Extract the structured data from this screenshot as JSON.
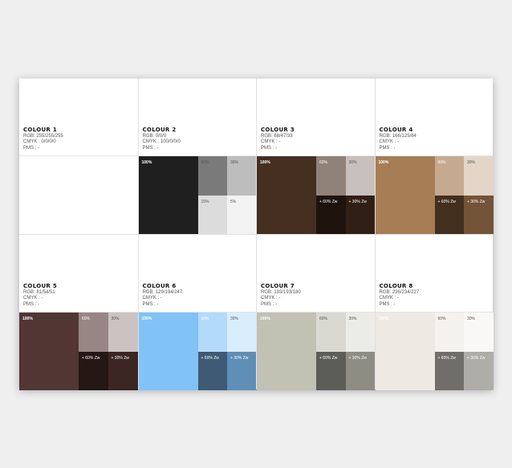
{
  "colours": [
    {
      "name": "COLOUR 1",
      "rgb": "RGB: 255/255/255",
      "cmyk": "CMYK : 0/0/0/0",
      "pms": "PMS : -",
      "swatches": {
        "main": {
          "color": "#ffffff",
          "label": ""
        },
        "t1": {
          "color": "#ffffff",
          "label": ""
        },
        "t2": {
          "color": "#ffffff",
          "label": ""
        },
        "b1": {
          "color": "#ffffff",
          "label": ""
        },
        "b2": {
          "color": "#ffffff",
          "label": ""
        }
      }
    },
    {
      "name": "COLOUR 2",
      "rgb": "RGB: 0/0/0",
      "cmyk": "CMYK : 100/0/0/0",
      "pms": "PMS : -",
      "swatches": {
        "main": {
          "color": "#1f1f1f",
          "label": "100%",
          "tone": "light"
        },
        "t1": {
          "color": "#7a7a7a",
          "label": "60%",
          "tone": "dark"
        },
        "t2": {
          "color": "#bdbdbd",
          "label": "30%",
          "tone": "dark"
        },
        "b1": {
          "color": "#dcdcdc",
          "label": "15%",
          "tone": "dark"
        },
        "b2": {
          "color": "#f3f3f3",
          "label": "5%",
          "tone": "dark"
        }
      }
    },
    {
      "name": "COLOUR 3",
      "rgb": "RGB: 68/47/33",
      "cmyk": "CMYK : -",
      "pms": "PMS : -",
      "swatches": {
        "main": {
          "color": "#442f21",
          "label": "100%",
          "tone": "light"
        },
        "t1": {
          "color": "#8f8279",
          "label": "60%",
          "tone": "light"
        },
        "t2": {
          "color": "#c7c0bc",
          "label": "30%",
          "tone": "dark"
        },
        "b1": {
          "color": "#1e130d",
          "label": "+ 60% Zw",
          "tone": "light"
        },
        "b2": {
          "color": "#301f15",
          "label": "+ 30% Zw",
          "tone": "light"
        }
      }
    },
    {
      "name": "COLOUR 4",
      "rgb": "RGB: 166/125/84",
      "cmyk": "CMYK : -",
      "pms": "PMS : -",
      "swatches": {
        "main": {
          "color": "#a67d54",
          "label": "100%",
          "tone": "light"
        },
        "t1": {
          "color": "#c6aa90",
          "label": "60%",
          "tone": "light"
        },
        "t2": {
          "color": "#e3d5c8",
          "label": "30%",
          "tone": "dark"
        },
        "b1": {
          "color": "#432f1e",
          "label": "+ 60% Zw",
          "tone": "light"
        },
        "b2": {
          "color": "#735438",
          "label": "+ 30% Zw",
          "tone": "light"
        }
      }
    },
    {
      "name": "COLOUR 5",
      "rgb": "RGB: 81/54/51",
      "cmyk": "CMYK : -",
      "pms": "PMS : -",
      "swatches": {
        "main": {
          "color": "#513633",
          "label": "100%",
          "tone": "light"
        },
        "t1": {
          "color": "#978685",
          "label": "60%",
          "tone": "light"
        },
        "t2": {
          "color": "#cbc2c1",
          "label": "30%",
          "tone": "dark"
        },
        "b1": {
          "color": "#241716",
          "label": "+ 60% Zw",
          "tone": "light"
        },
        "b2": {
          "color": "#3b2624",
          "label": "+ 30% Zw",
          "tone": "light"
        }
      }
    },
    {
      "name": "COLOUR 6",
      "rgb": "RGB: 129/194/247",
      "cmyk": "CMYK : -",
      "pms": "PMS : -",
      "swatches": {
        "main": {
          "color": "#81c2f7",
          "label": "100%",
          "tone": "light"
        },
        "t1": {
          "color": "#b3dafa",
          "label": "60%",
          "tone": "light"
        },
        "t2": {
          "color": "#d9edfc",
          "label": "30%",
          "tone": "dark"
        },
        "b1": {
          "color": "#3f5a75",
          "label": "+ 60% Zw",
          "tone": "light"
        },
        "b2": {
          "color": "#5f8eb6",
          "label": "+ 30% Zw",
          "tone": "light"
        }
      }
    },
    {
      "name": "COLOUR 7",
      "rgb": "RGB: 193/193/180",
      "cmyk": "CMYK : -",
      "pms": "PMS : -",
      "swatches": {
        "main": {
          "color": "#c1c1b4",
          "label": "100%",
          "tone": "light"
        },
        "t1": {
          "color": "#d9d9d1",
          "label": "60%",
          "tone": "dark"
        },
        "t2": {
          "color": "#ecece7",
          "label": "30%",
          "tone": "dark"
        },
        "b1": {
          "color": "#5d5d58",
          "label": "+ 60% Zw",
          "tone": "light"
        },
        "b2": {
          "color": "#8d8d84",
          "label": "+ 30% Zw",
          "tone": "light"
        }
      }
    },
    {
      "name": "COLOUR 8",
      "rgb": "RGB: 236/234/227",
      "cmyk": "CMYK : -",
      "pms": "PMS : -",
      "swatches": {
        "main": {
          "color": "#eceae3",
          "label": "100%",
          "tone": "light"
        },
        "t1": {
          "color": "#f3f2ee",
          "label": "60%",
          "tone": "dark"
        },
        "t2": {
          "color": "#f9f8f6",
          "label": "30%",
          "tone": "dark"
        },
        "b1": {
          "color": "#6f6e6b",
          "label": "+ 60% Zw",
          "tone": "light"
        },
        "b2": {
          "color": "#aeada8",
          "label": "+ 30% Zw",
          "tone": "light"
        }
      }
    }
  ]
}
